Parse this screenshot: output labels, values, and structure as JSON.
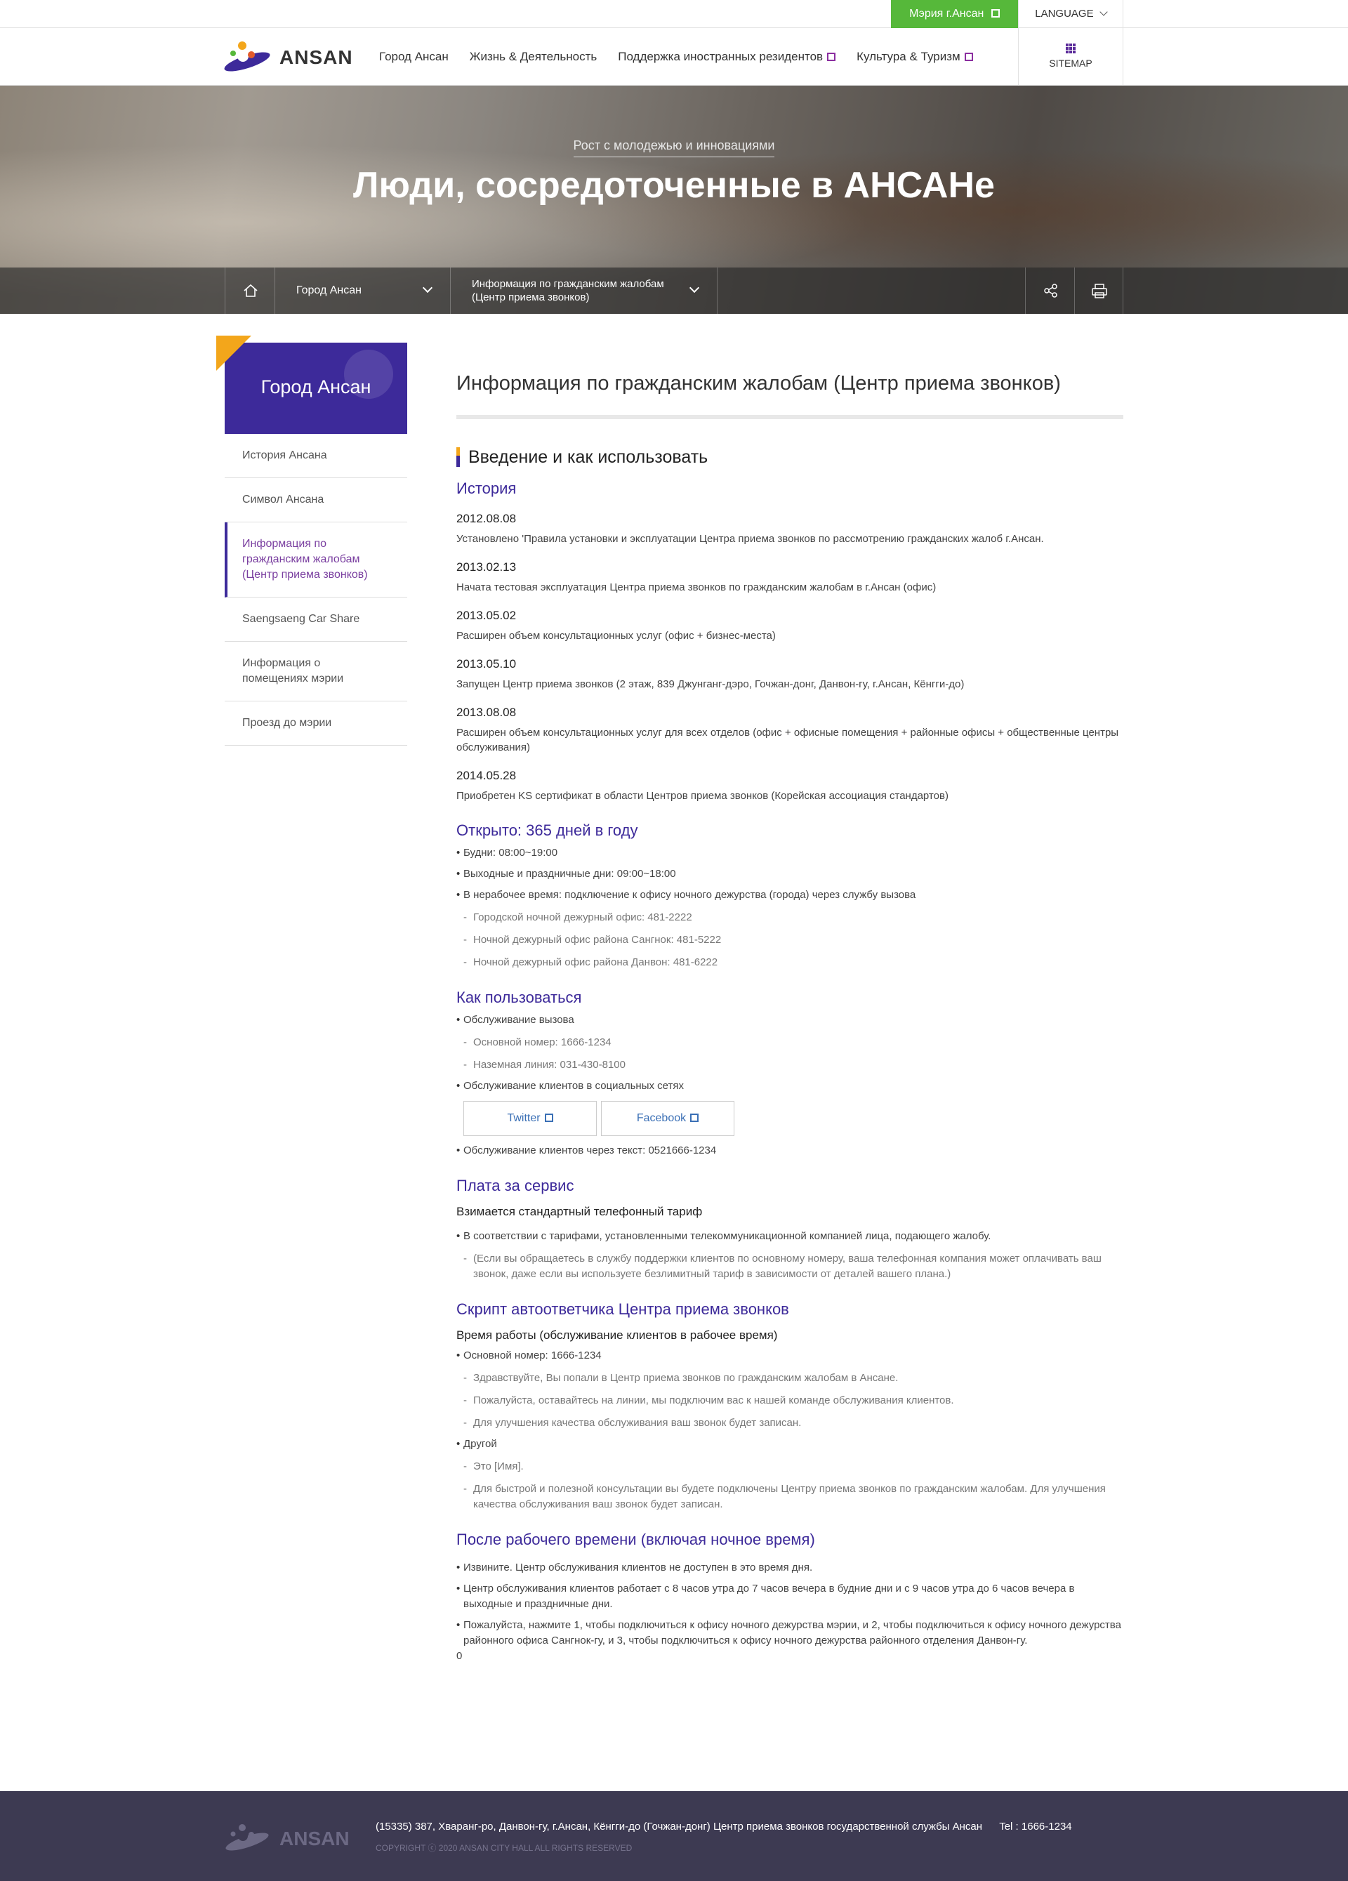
{
  "topbar": {
    "mayor_label": "Мэрия г.Ансан",
    "language_label": "LANGUAGE"
  },
  "header": {
    "logo_text": "ANSAN",
    "nav": [
      {
        "label": "Город Ансан",
        "external": false
      },
      {
        "label": "Жизнь & Деятельность",
        "external": false
      },
      {
        "label": "Поддержка иностранных резидентов",
        "external": true
      },
      {
        "label": "Культура & Туризм",
        "external": true
      }
    ],
    "sitemap_label": "SITEMAP"
  },
  "hero": {
    "subtitle": "Рост с молодежью и инновациями",
    "title": "Люди, сосредоточенные в АНСАНе"
  },
  "breadcrumb": {
    "level1": "Город Ансан",
    "level2": "Информация по гражданским жалобам (Центр приема звонков)"
  },
  "sidebar": {
    "title": "Город Ансан",
    "items": [
      {
        "label": "История Ансана",
        "active": false
      },
      {
        "label": "Символ Ансана",
        "active": false
      },
      {
        "label": "Информация по гражданским жалобам (Центр приема звонков)",
        "active": true
      },
      {
        "label": "Saengsaeng Car Share",
        "active": false
      },
      {
        "label": "Информация о помещениях мэрии",
        "active": false
      },
      {
        "label": "Проезд до мэрии",
        "active": false
      }
    ]
  },
  "content": {
    "page_title": "Информация по гражданским жалобам (Центр приема звонков)",
    "section_title": "Введение и как использовать",
    "history": {
      "heading": "История",
      "entries": [
        {
          "date": "2012.08.08",
          "text": "Установлено 'Правила установки и эксплуатации Центра приема звонков по рассмотрению гражданских жалоб г.Ансан."
        },
        {
          "date": "2013.02.13",
          "text": "Начата тестовая эксплуатация Центра приема звонков по гражданским жалобам в г.Ансан (офис)"
        },
        {
          "date": "2013.05.02",
          "text": "Расширен объем консультационных услуг (офис + бизнес-места)"
        },
        {
          "date": "2013.05.10",
          "text": "Запущен Центр приема звонков (2 этаж, 839 Джунганг-дэро, Гочжан-донг, Данвон-гу, г.Ансан, Кёнгги-до)"
        },
        {
          "date": "2013.08.08",
          "text": "Расширен объем консультационных услуг для всех отделов (офис + офисные помещения + районные офисы + общественные центры обслуживания)"
        },
        {
          "date": "2014.05.28",
          "text": "Приобретен KS сертификат в области Центров приема звонков (Корейская ассоциация стандартов)"
        }
      ]
    },
    "open": {
      "heading": "Открыто: 365 дней в году",
      "items": [
        {
          "type": "bul",
          "text": "Будни: 08:00~19:00"
        },
        {
          "type": "bul",
          "text": "Выходные и праздничные дни: 09:00~18:00"
        },
        {
          "type": "bul",
          "text": "В нерабочее время: подключение к офису ночного дежурства (города) через службу вызова"
        },
        {
          "type": "sub",
          "text": "Городской ночной дежурный офис: 481-2222"
        },
        {
          "type": "sub",
          "text": "Ночной дежурный офис района Сангнок: 481-5222"
        },
        {
          "type": "sub",
          "text": "Ночной дежурный офис района Данвон: 481-6222"
        }
      ]
    },
    "howto": {
      "heading": "Как пользоваться",
      "items_before": [
        {
          "type": "bul",
          "text": "Обслуживание вызова"
        },
        {
          "type": "sub",
          "text": "Основной номер: 1666-1234"
        },
        {
          "type": "sub",
          "text": "Наземная линия: 031-430-8100"
        },
        {
          "type": "bul",
          "text": "Обслуживание клиентов в социальных сетях"
        }
      ],
      "twitter_label": "Twitter",
      "facebook_label": "Facebook",
      "items_after": [
        {
          "type": "bul",
          "text": "Обслуживание клиентов через текст: 0521666-1234"
        }
      ]
    },
    "fee": {
      "heading": "Плата за сервис",
      "subheading": "Взимается стандартный телефонный тариф",
      "items": [
        {
          "type": "bul",
          "text": "В соответствии с тарифами, установленными телекоммуникационной компанией лица, подающего жалобу."
        },
        {
          "type": "sub",
          "text": "(Если вы обращаетесь в службу поддержки клиентов по основному номеру, ваша телефонная компания может оплачивать ваш звонок, даже если вы используете безлимитный тариф в зависимости от деталей вашего плана.)"
        }
      ]
    },
    "script": {
      "heading": "Скрипт автоответчика Центра приема звонков",
      "subheading": "Время работы (обслуживание клиентов в рабочее время)",
      "items": [
        {
          "type": "bul",
          "text": "Основной номер: 1666-1234"
        },
        {
          "type": "sub",
          "text": "Здравствуйте, Вы попали в Центр приема звонков по гражданским жалобам в Ансане."
        },
        {
          "type": "sub",
          "text": "Пожалуйста, оставайтесь на линии, мы подключим вас к нашей команде обслуживания клиентов."
        },
        {
          "type": "sub",
          "text": "Для улучшения качества обслуживания ваш звонок будет записан."
        },
        {
          "type": "bul",
          "text": "Другой"
        },
        {
          "type": "sub",
          "text": "Это [Имя]."
        },
        {
          "type": "sub",
          "text": "Для быстрой и полезной консультации вы будете подключены Центру приема звонков по гражданским жалобам. Для улучшения качества обслуживания ваш звонок будет записан."
        }
      ]
    },
    "after": {
      "heading": "После рабочего времени (включая ночное время)",
      "items": [
        {
          "type": "bul",
          "text": "Извините. Центр обслуживания клиентов не доступен в это время дня."
        },
        {
          "type": "bul",
          "text": "Центр обслуживания клиентов работает с 8 часов утра до 7 часов вечера в будние дни и с 9 часов утра до 6 часов вечера в выходные и праздничные дни."
        },
        {
          "type": "bul",
          "text": "Пожалуйста, нажмите 1, чтобы подключиться к офису ночного дежурства мэрии, и 2, чтобы подключиться к офису ночного дежурства районного офиса Сангнок-гу, и 3, чтобы подключиться к офису ночного дежурства районного отделения Данвон-гу."
        }
      ],
      "trailing": "0"
    }
  },
  "footer": {
    "logo_text": "ANSAN",
    "address": "(15335) 387, Хваранг-ро, Данвон-гу, г.Ансан, Кёнгги-до (Гочжан-донг) Центр приема звонков государственной службы Ансан",
    "tel": "Tel : 1666-1234",
    "copyright": "COPYRIGHT ⓒ 2020 ANSAN CITY HALL ALL RIGHTS RESERVED"
  },
  "colors": {
    "brand_purple": "#3d2a9a",
    "accent_orange": "#f3a61b",
    "mayor_green": "#56b83a",
    "footer_bg": "#3d3a52"
  },
  "icons": [
    "external-link-icon",
    "chevron-down-icon",
    "home-icon",
    "share-icon",
    "print-icon",
    "sitemap-grid-icon"
  ]
}
